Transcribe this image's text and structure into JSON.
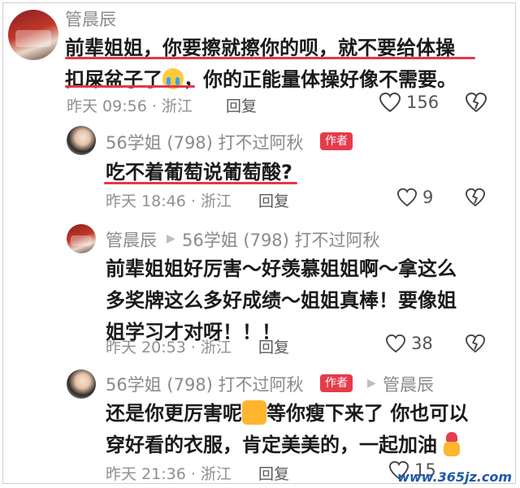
{
  "comments": [
    {
      "author": "管晨辰",
      "lines": [
        "前辈姐姐，你要擦就擦你的呗，就不要给体操",
        "扣屎盆子了",
        "，你的正能量体操好像不需要。"
      ],
      "time": "昨天 09:56 · 浙江",
      "reply": "回复",
      "likes": "156"
    },
    {
      "author": "56学姐 (798) 打不过阿秋",
      "badge": "作者",
      "lines": [
        "吃不着葡萄说葡萄酸?"
      ],
      "time": "昨天 18:46 · 浙江",
      "reply": "回复",
      "likes": "9"
    },
    {
      "author": "管晨辰",
      "reply_to": "56学姐 (798) 打不过阿秋",
      "lines": [
        "前辈姐姐好厉害～好羡慕姐姐啊～拿这么",
        "多奖牌这么多好成绩～姐姐真棒！要像姐",
        "姐学习才对呀！！！"
      ],
      "time": "昨天 20:53 · 浙江",
      "reply": "回复",
      "likes": "38"
    },
    {
      "author": "56学姐 (798) 打不过阿秋",
      "badge": "作者",
      "reply_to": "管晨辰",
      "lines": [
        "还是你更厉害呢",
        "等你瘦下来了 你也可以",
        "穿好看的衣服，肯定美美的，一起加油"
      ],
      "time": "昨天 21:36 · 浙江",
      "reply": "回复",
      "likes": "15"
    }
  ],
  "watermark": "www.365jz.com",
  "colors": {
    "underline": "#e2384a",
    "badge": "#e63b4a"
  }
}
